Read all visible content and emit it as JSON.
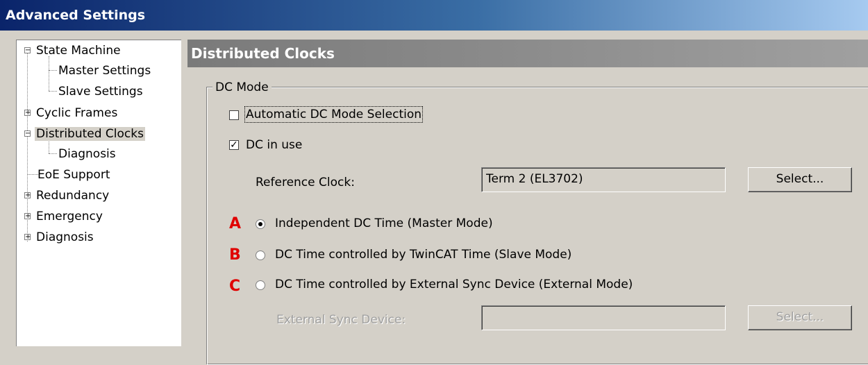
{
  "window": {
    "title": "Advanced Settings"
  },
  "tree": {
    "items": [
      {
        "label": "State Machine",
        "expander": "⊟"
      },
      {
        "label": "Master Settings"
      },
      {
        "label": "Slave Settings"
      },
      {
        "label": "Cyclic Frames",
        "expander": "⊞"
      },
      {
        "label": "Distributed Clocks",
        "expander": "⊟",
        "selected": true
      },
      {
        "label": "Diagnosis"
      },
      {
        "label": "EoE Support"
      },
      {
        "label": "Redundancy",
        "expander": "⊞"
      },
      {
        "label": "Emergency",
        "expander": "⊞"
      },
      {
        "label": "Diagnosis",
        "expander": "⊞"
      }
    ]
  },
  "panel": {
    "title": "Distributed Clocks",
    "group_title": "DC Mode",
    "auto_dc": {
      "label": "Automatic DC Mode Selection",
      "checked": false
    },
    "dc_in_use": {
      "label": "DC in use",
      "checked": true
    },
    "reference_clock": {
      "label": "Reference Clock:",
      "value": "Term 2 (EL3702)",
      "button": "Select..."
    },
    "modes": [
      {
        "marker": "A",
        "label": "Independent DC Time (Master Mode)",
        "selected": true
      },
      {
        "marker": "B",
        "label": "DC Time controlled by TwinCAT Time (Slave Mode)",
        "selected": false
      },
      {
        "marker": "C",
        "label": "DC Time controlled by External Sync Device (External Mode)",
        "selected": false
      }
    ],
    "external_sync": {
      "label": "External Sync Device:",
      "value": "",
      "button": "Select..."
    }
  },
  "colors": {
    "marker": "#e00000",
    "title_gradient_start": "#0a246a",
    "title_gradient_end": "#a6caf0"
  }
}
